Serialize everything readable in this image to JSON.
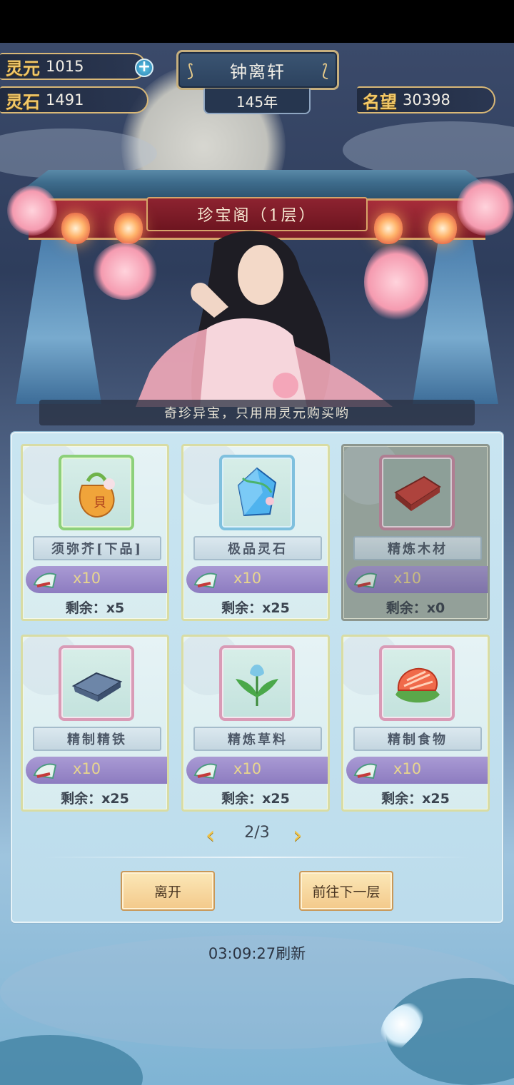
{
  "hud": {
    "lingyuan_label": "灵元",
    "lingyuan_value": "1015",
    "lingshi_label": "灵石",
    "lingshi_value": "1491",
    "location": "钟离轩",
    "year": "145年",
    "fame_label": "名望",
    "fame_value": "30398"
  },
  "shop": {
    "gate_title": "珍宝阁（1层）",
    "caption": "奇珍异宝，只用用灵元购买哟",
    "items": [
      {
        "name": "须弥芥[下品]",
        "price": "x10",
        "remain": "剩余：x5",
        "icon": "pouch-icon"
      },
      {
        "name": "极品灵石",
        "price": "x10",
        "remain": "剩余：x25",
        "icon": "crystal-icon"
      },
      {
        "name": "精炼木材",
        "price": "x10",
        "remain": "剩余：x0",
        "icon": "wood-icon"
      },
      {
        "name": "精制精铁",
        "price": "x10",
        "remain": "剩余：x25",
        "icon": "iron-ingot-icon"
      },
      {
        "name": "精炼草料",
        "price": "x10",
        "remain": "剩余：x25",
        "icon": "herb-icon"
      },
      {
        "name": "精制食物",
        "price": "x10",
        "remain": "剩余：x25",
        "icon": "meat-icon"
      }
    ],
    "page": "2/3",
    "leave_label": "离开",
    "next_floor_label": "前往下一层",
    "refresh": "03:09:27刷新"
  }
}
